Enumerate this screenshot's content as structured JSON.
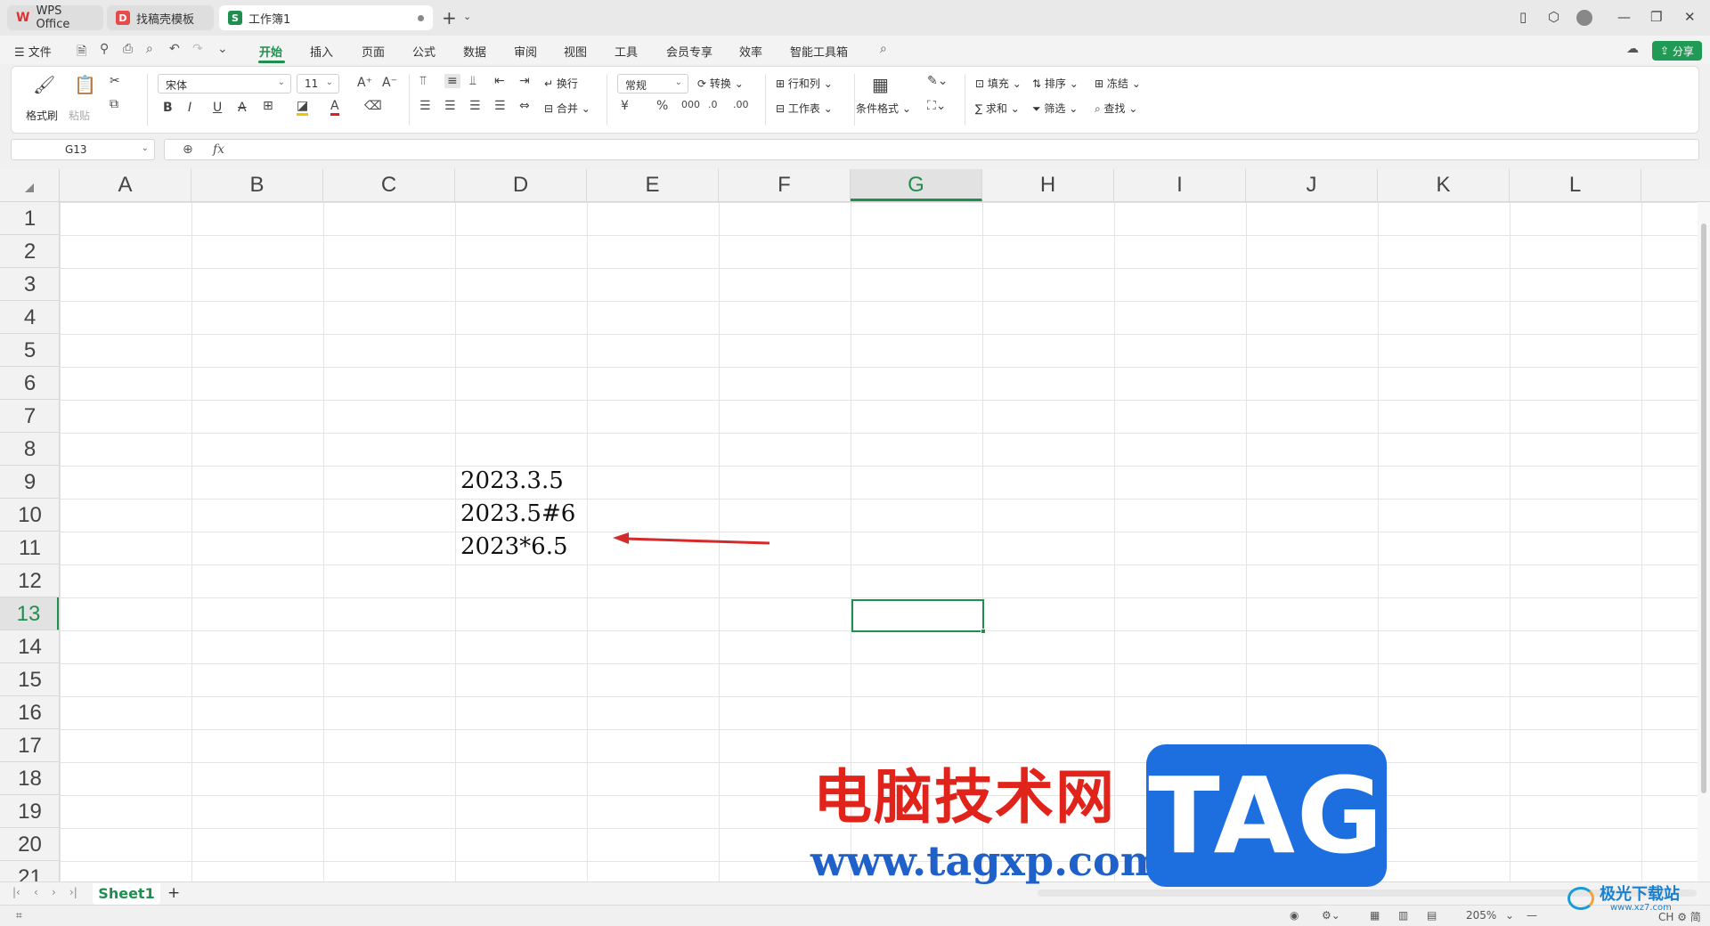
{
  "tabs": [
    {
      "label": "WPS Office",
      "icon": "wps-logo-icon"
    },
    {
      "label": "找稿壳模板",
      "icon": "template-icon"
    },
    {
      "label": "工作簿1",
      "icon": "sheet-icon"
    }
  ],
  "menu": {
    "file": "文件",
    "items": [
      "开始",
      "插入",
      "页面",
      "公式",
      "数据",
      "审阅",
      "视图",
      "工具",
      "会员专享",
      "效率",
      "智能工具箱"
    ],
    "share": "分享"
  },
  "ribbon": {
    "format_painter": "格式刷",
    "paste": "粘贴",
    "font_name": "宋体",
    "font_size": "11",
    "wrap": "换行",
    "merge": "合并",
    "number_format": "常规",
    "convert": "转换",
    "rows_cols": "行和列",
    "worksheet": "工作表",
    "cond_format": "条件格式",
    "fill": "填充",
    "sort": "排序",
    "freeze": "冻结",
    "sum": "求和",
    "filter": "筛选",
    "find": "查找"
  },
  "formula_bar": {
    "name_box": "G13",
    "fx": "fx",
    "value": ""
  },
  "columns": [
    "A",
    "B",
    "C",
    "D",
    "E",
    "F",
    "G",
    "H",
    "I",
    "J",
    "K",
    "L"
  ],
  "rows": [
    "1",
    "2",
    "3",
    "4",
    "5",
    "6",
    "7",
    "8",
    "9",
    "10",
    "11",
    "12",
    "13",
    "14",
    "15",
    "16",
    "17",
    "18",
    "19",
    "20",
    "21"
  ],
  "selected_cell": "G13",
  "cells": [
    {
      "ref": "D9",
      "value": "2023.3.5"
    },
    {
      "ref": "D10",
      "value": "2023.5#6"
    },
    {
      "ref": "D11",
      "value": "2023*6.5"
    }
  ],
  "sheets": [
    "Sheet1"
  ],
  "status": {
    "zoom": "205%",
    "ime": "CH ⚙ 简"
  },
  "watermarks": {
    "cn_text": "电脑技术网",
    "url": "www.tagxp.com",
    "tag": "TAG",
    "site2": "极光下载站",
    "site2_url": "www.xz7.com"
  },
  "colors": {
    "accent": "#1f8f4f",
    "arrow": "#d42a2a"
  }
}
